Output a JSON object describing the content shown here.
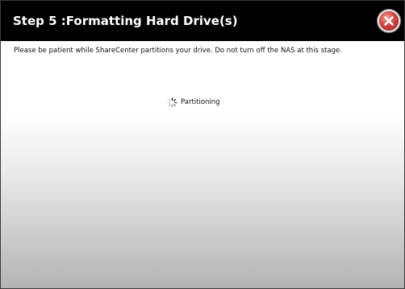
{
  "dialog": {
    "title": "Step 5 :Formatting Hard Drive(s)",
    "message": "Please be patient while ShareCenter partitions your drive. Do not turn off the NAS at this stage.",
    "status_text": "Partitioning",
    "close_icon": "close-icon",
    "spinner_icon": "loading-spinner-icon"
  },
  "colors": {
    "titlebar": "#000000",
    "title_text": "#ffffff",
    "close_button": "#d2463f"
  }
}
